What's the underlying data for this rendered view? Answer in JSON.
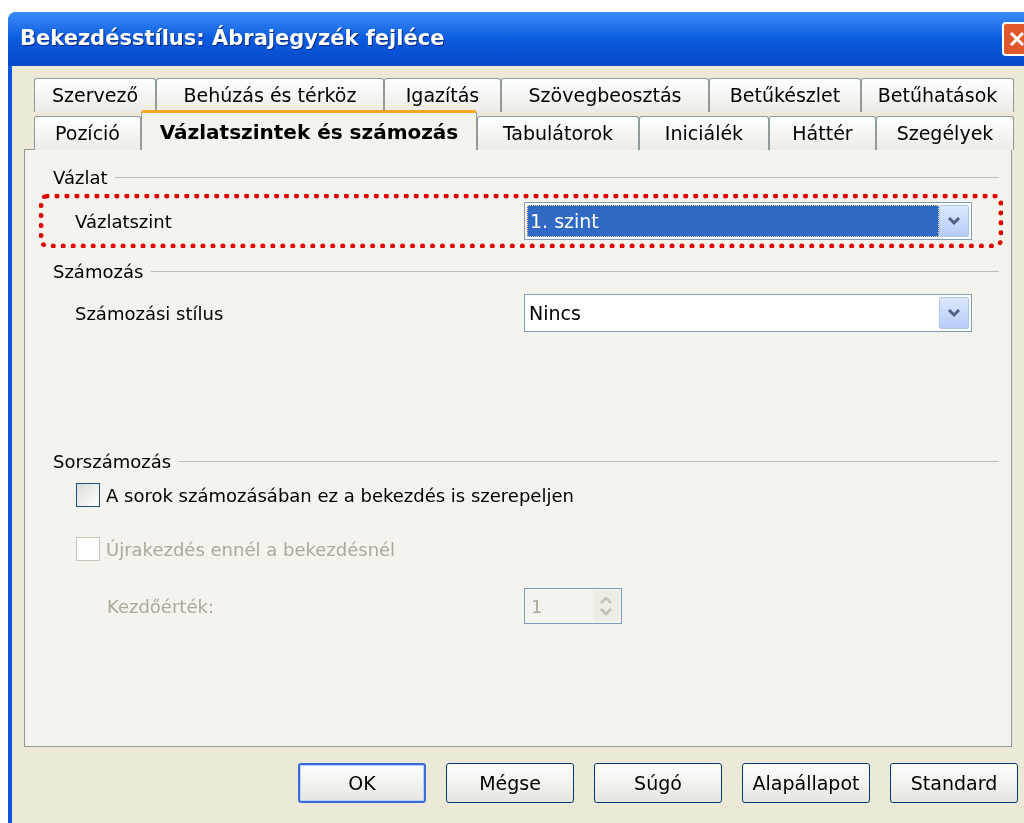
{
  "window": {
    "title": "Bekezdésstílus: Ábrajegyzék fejléce"
  },
  "tab_rows": [
    [
      {
        "label": "Szervező",
        "selected": false
      },
      {
        "label": "Behúzás és térköz",
        "selected": false
      },
      {
        "label": "Igazítás",
        "selected": false
      },
      {
        "label": "Szövegbeosztás",
        "selected": false
      },
      {
        "label": "Betűkészlet",
        "selected": false
      },
      {
        "label": "Betűhatások",
        "selected": false
      }
    ],
    [
      {
        "label": "Pozíció",
        "selected": false
      },
      {
        "label": "Vázlatszintek és számozás",
        "selected": true
      },
      {
        "label": "Tabulátorok",
        "selected": false
      },
      {
        "label": "Iniciálék",
        "selected": false
      },
      {
        "label": "Háttér",
        "selected": false
      },
      {
        "label": "Szegélyek",
        "selected": false
      }
    ]
  ],
  "outline": {
    "heading": "Vázlat",
    "label": "Vázlatszint",
    "value": "1. szint",
    "highlighted": true
  },
  "numbering": {
    "heading": "Számozás",
    "label": "Számozási stílus",
    "value": "Nincs"
  },
  "line_numbering": {
    "heading": "Sorszámozás",
    "checkboxes": [
      {
        "label": "A sorok számozásában ez a bekezdés is szerepeljen",
        "checked": false,
        "disabled": false
      },
      {
        "label": "Újrakezdés ennél a bekezdésnél",
        "checked": false,
        "disabled": true
      }
    ],
    "start": {
      "label": "Kezdőérték:",
      "value": "1",
      "disabled": true
    }
  },
  "buttons": [
    {
      "label": "OK",
      "default": true
    },
    {
      "label": "Mégse",
      "default": false
    },
    {
      "label": "Súgó",
      "default": false
    },
    {
      "label": "Alapállapot",
      "default": false
    },
    {
      "label": "Standard",
      "default": false
    }
  ]
}
